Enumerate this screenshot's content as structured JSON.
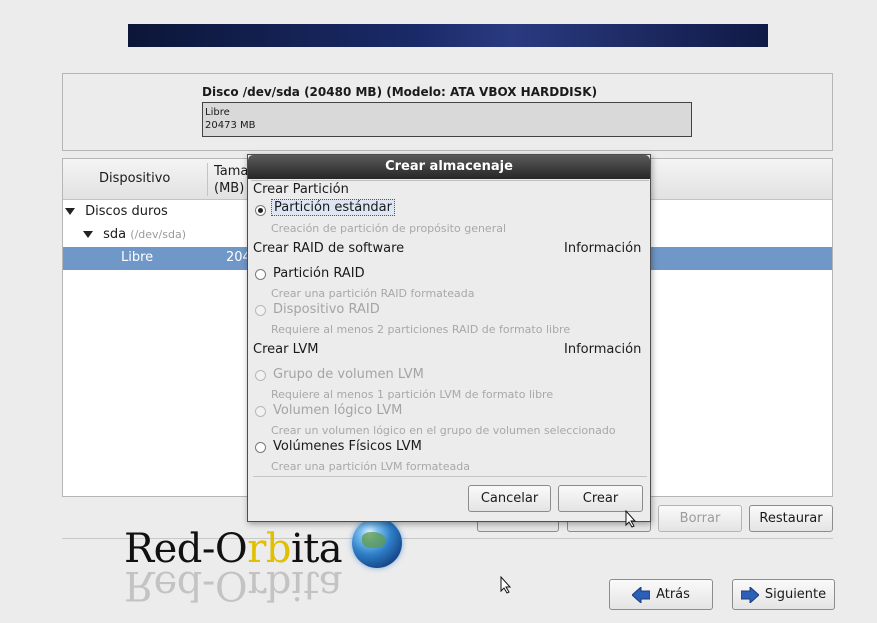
{
  "disk": {
    "title": "Disco /dev/sda (20480 MB) (Modelo: ATA VBOX HARDDISK)",
    "bar_label": "Libre",
    "bar_size": "20473 MB"
  },
  "table": {
    "col_device": "Dispositivo",
    "col_size_1": "Tama",
    "col_size_2": "(MB)",
    "rows": [
      {
        "label": "Discos duros"
      },
      {
        "label": "sda",
        "sub": "(/dev/sda)"
      },
      {
        "label": "Libre",
        "size": "204"
      }
    ]
  },
  "bottom_buttons": {
    "delete": "Borrar",
    "restore": "Restaurar"
  },
  "nav": {
    "back": "Atrás",
    "next": "Siguiente"
  },
  "logo": {
    "text_red": "Red-O",
    "text_r": "r",
    "text_b": "b",
    "text_ita": "ita"
  },
  "dialog": {
    "title": "Crear almacenaje",
    "section_partition": "Crear Partición",
    "opt_standard": "Partición estándar",
    "desc_standard": "Creación de partición de propósito general",
    "section_raid": "Crear RAID de software",
    "info_raid": "Información",
    "opt_raid_partition": "Partición RAID",
    "desc_raid_partition": "Crear una partición RAID formateada",
    "opt_raid_device": "Dispositivo RAID",
    "desc_raid_device": "Requiere al menos 2 particiones RAID de formato libre",
    "section_lvm": "Crear LVM",
    "info_lvm": "Información",
    "opt_lvm_vg": "Grupo de volumen LVM",
    "desc_lvm_vg": "Requiere al menos 1 partición LVM de formato libre",
    "opt_lvm_lv": "Volumen lógico LVM",
    "desc_lvm_lv": "Crear un volumen lógico en el grupo de volumen seleccionado",
    "opt_lvm_pv": "Volúmenes Físicos LVM",
    "desc_lvm_pv": "Crear una partición LVM formateada",
    "cancel": "Cancelar",
    "create": "Crear"
  }
}
